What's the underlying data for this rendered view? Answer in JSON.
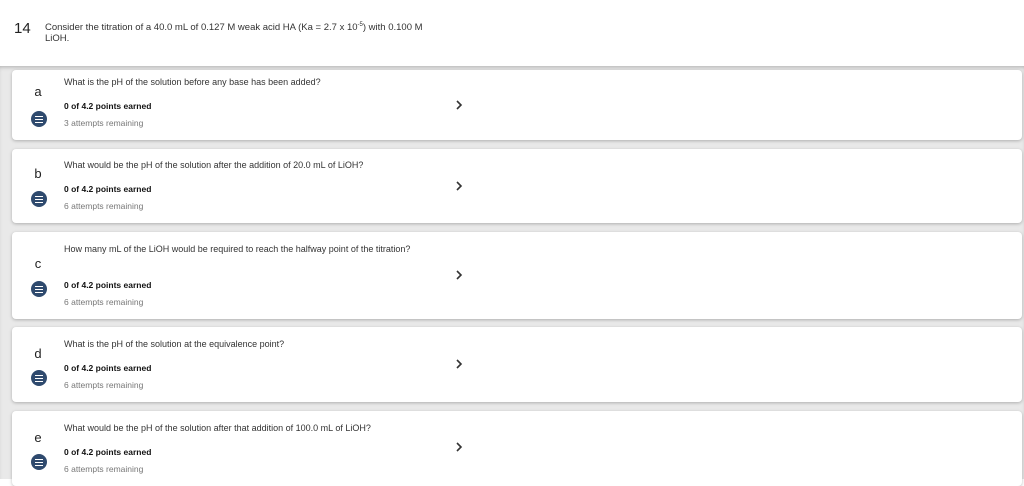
{
  "question": {
    "number": "14",
    "text_main": "Consider the titration of a 40.0 mL of 0.127 M weak acid HA (Ka = 2.7 x 10",
    "text_sup": "-5",
    "text_end": ") with 0.100 M LiOH."
  },
  "parts": [
    {
      "letter": "a",
      "prompt": "What is the pH of the solution before any base has been added?",
      "score": "0 of 4.2 points earned",
      "attempts": "3 attempts remaining"
    },
    {
      "letter": "b",
      "prompt": "What would be the pH of the solution after the addition of 20.0 mL of LiOH?",
      "score": "0 of 4.2 points earned",
      "attempts": "6 attempts remaining"
    },
    {
      "letter": "c",
      "prompt": "How many mL of the LiOH would be required to reach the halfway point of the titration?",
      "score": "0 of 4.2 points earned",
      "attempts": "6 attempts remaining"
    },
    {
      "letter": "d",
      "prompt": "What is the pH of the solution at the equivalence point?",
      "score": "0 of 4.2 points earned",
      "attempts": "6 attempts remaining"
    },
    {
      "letter": "e",
      "prompt": "What would be the pH of the solution after that addition of 100.0 mL of LiOH?",
      "score": "0 of 4.2 points earned",
      "attempts": "6 attempts remaining"
    }
  ],
  "icons": {
    "part_icon": "list-icon",
    "expand_icon": "chevron-right-icon"
  },
  "colors": {
    "icon_bg": "#2f4a6e",
    "list_bg": "#e9e9e9"
  }
}
